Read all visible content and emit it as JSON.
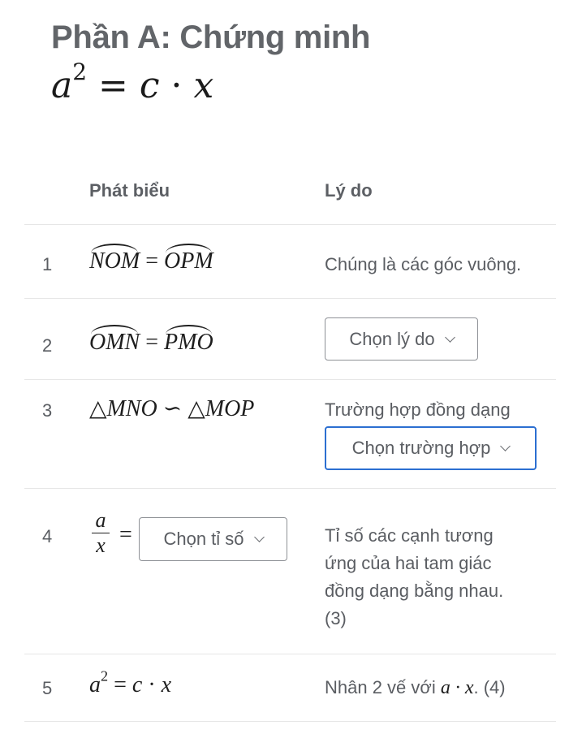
{
  "header": {
    "title": "Phần A: Chứng minh",
    "subtitle_math": "a² = c · x"
  },
  "table": {
    "columns": [
      "Phát biểu",
      "Lý do"
    ],
    "rows": [
      {
        "number": "1",
        "statement": {
          "left": "NOM",
          "right": "OPM",
          "type": "angle-equality"
        },
        "reason": "Chúng là các góc vuông."
      },
      {
        "number": "2",
        "statement": {
          "left": "OMN",
          "right": "PMO",
          "type": "angle-equality"
        },
        "reason_dropdown": {
          "placeholder": "Chọn lý do",
          "focused": false
        }
      },
      {
        "number": "3",
        "statement": {
          "text": "△MNO ∽ △MOP"
        },
        "reason": "Trường hợp đồng dạng",
        "reason_dropdown": {
          "placeholder": "Chọn trường hợp",
          "focused": true
        }
      },
      {
        "number": "4",
        "statement": {
          "numerator": "a",
          "denominator": "x",
          "equals": "=",
          "dropdown": {
            "placeholder": "Chọn tỉ số",
            "focused": false
          }
        },
        "reason": "Tỉ số các cạnh tương ứng của hai tam giác đồng dạng bằng nhau. (3)"
      },
      {
        "number": "5",
        "statement": {
          "text": "a² = c · x"
        },
        "reason_prefix": "Nhân 2 vế với ",
        "reason_math": "a · x",
        "reason_suffix": ". (4)"
      }
    ]
  },
  "colors": {
    "focus_border": "#2c6fd1",
    "text": "#5a5d62",
    "divider": "#e6e6e6"
  }
}
